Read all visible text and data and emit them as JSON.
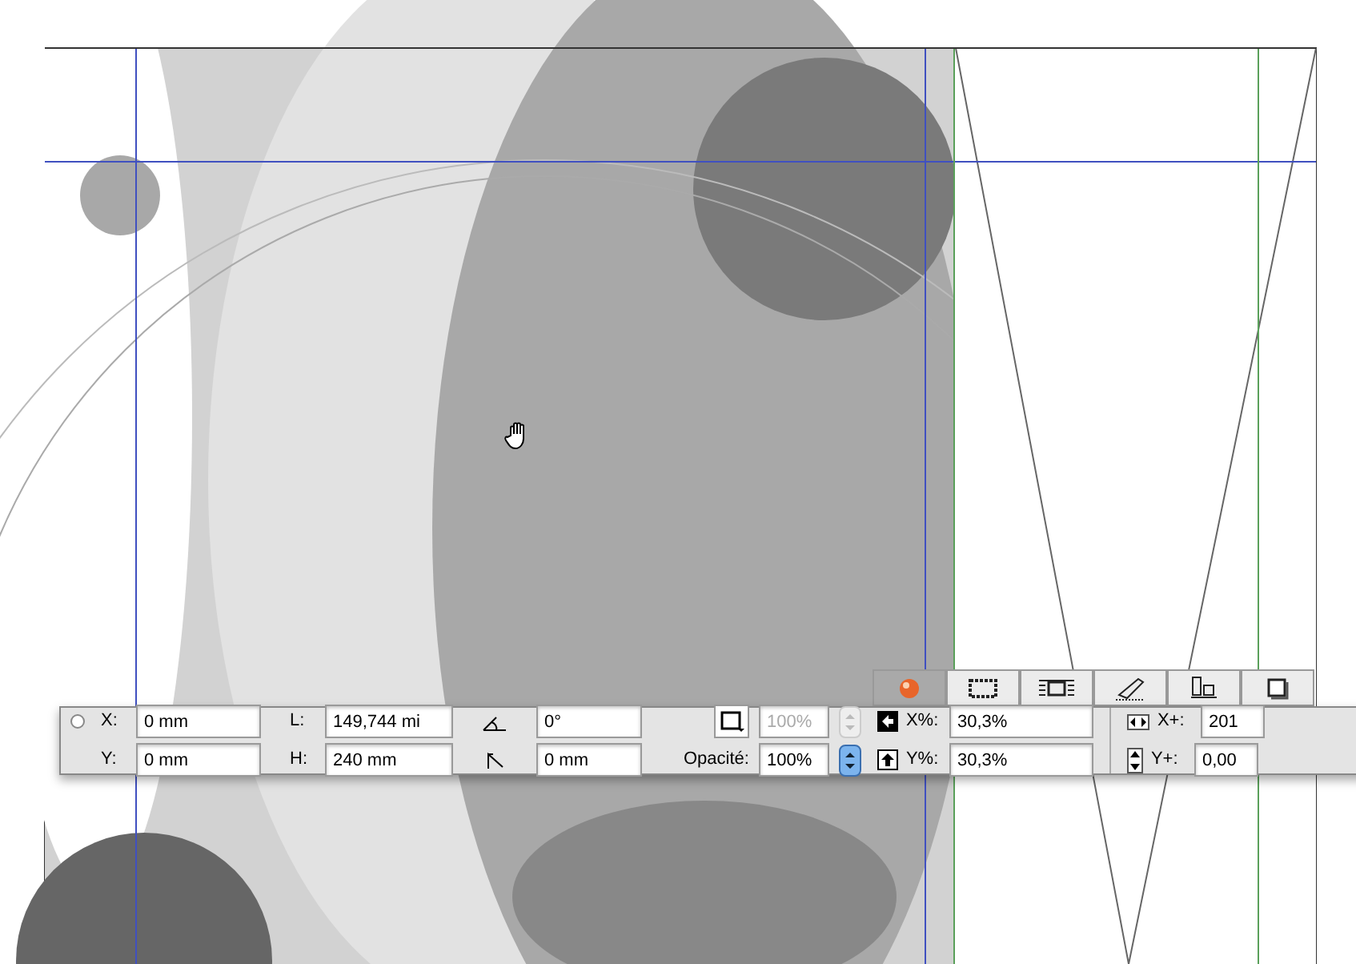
{
  "panel_tabs": [
    {
      "selected": true
    },
    {
      "selected": false
    },
    {
      "selected": false
    },
    {
      "selected": false
    },
    {
      "selected": false
    },
    {
      "selected": false
    }
  ],
  "geometry": [
    {
      "label": "X:",
      "value": "0 mm"
    },
    {
      "label": "Y:",
      "value": "0 mm"
    }
  ],
  "size": [
    {
      "label": "L:",
      "value": "149,744 mi"
    },
    {
      "label": "H:",
      "value": "240 mm"
    }
  ],
  "angles": [
    {
      "value": "0°"
    },
    {
      "value": "0 mm"
    }
  ],
  "opacity": [
    {
      "value": "100%",
      "disabled": true
    },
    {
      "label": "Opacité:",
      "value": "100%",
      "disabled": false
    }
  ],
  "scale": [
    {
      "label": "X%:",
      "value": "30,3%"
    },
    {
      "label": "Y%:",
      "value": "30,3%"
    }
  ],
  "offset": [
    {
      "label": "X+:",
      "value": "201"
    },
    {
      "label": "Y+:",
      "value": "0,00"
    }
  ]
}
